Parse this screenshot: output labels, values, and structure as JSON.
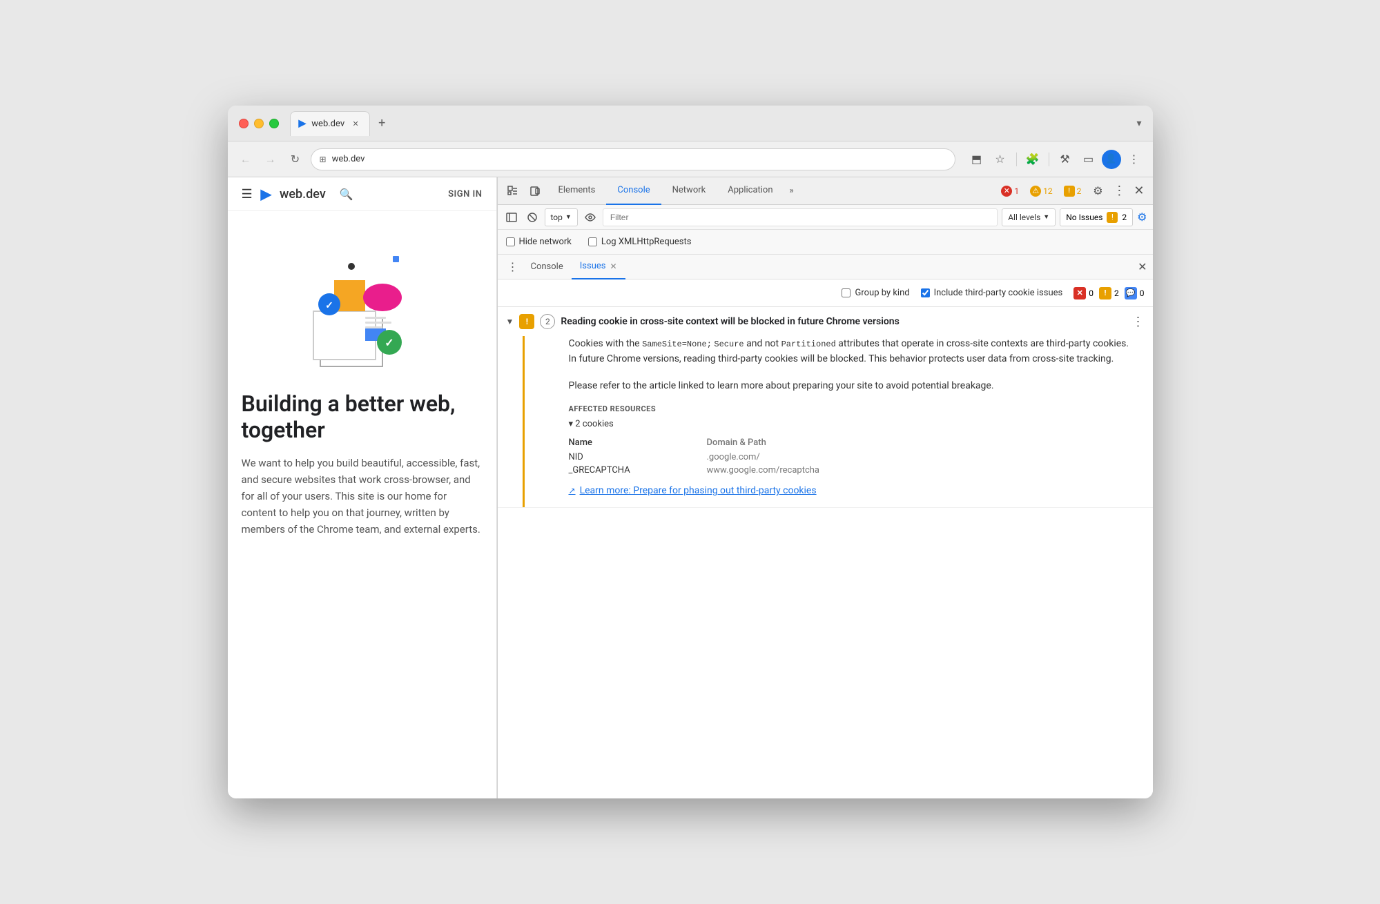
{
  "browser": {
    "title": "web.dev",
    "url": "web.dev",
    "favicon": "▶",
    "tab_close": "✕",
    "tab_new": "+",
    "back_btn": "←",
    "forward_btn": "→",
    "refresh_btn": "↻",
    "url_icon": "⊞"
  },
  "toolbar_icons": {
    "cast": "⬒",
    "bookmark": "☆",
    "extensions": "🧩",
    "devtools": "⚒",
    "profile": "👤",
    "menu": "⋮"
  },
  "site": {
    "hamburger": "☰",
    "logo": "▶",
    "name": "web.dev",
    "search": "🔍",
    "sign_in": "SIGN IN",
    "hero_title": "Building a better web, together",
    "hero_text": "We want to help you build beautiful, accessible, fast, and secure websites that work cross-browser, and for all of your users. This site is our home for content to help you on that journey, written by members of the Chrome team, and external experts."
  },
  "devtools": {
    "tabs": [
      {
        "label": "Elements",
        "active": false
      },
      {
        "label": "Console",
        "active": false
      },
      {
        "label": "Network",
        "active": false
      },
      {
        "label": "Application",
        "active": false
      },
      {
        "label": "»",
        "active": false
      }
    ],
    "active_tab": "Console",
    "error_count": "1",
    "warn_count": "12",
    "info_count": "2",
    "settings_icon": "⚙",
    "more_icon": "⋮",
    "close_icon": "✕",
    "inspect_icon": "⬚",
    "device_icon": "📱"
  },
  "console_toolbar": {
    "sidebar_icon": "▤",
    "clear_icon": "⊘",
    "context_label": "top",
    "dropdown_arrow": "▼",
    "eye_icon": "◉",
    "filter_placeholder": "Filter",
    "level_label": "All levels",
    "issues_label": "No Issues",
    "issues_count": "2",
    "settings_icon": "⚙"
  },
  "options": {
    "hide_network_label": "Hide network",
    "hide_network_checked": false,
    "log_xhr_label": "Log XMLHttpRequests",
    "log_xhr_checked": false
  },
  "sub_tabs": {
    "more_icon": "⋮",
    "tabs": [
      {
        "label": "Console",
        "active": false
      },
      {
        "label": "Issues",
        "active": true,
        "closeable": true
      }
    ],
    "close_icon": "✕"
  },
  "issues_options": {
    "group_by_kind_label": "Group by kind",
    "group_by_kind_checked": false,
    "include_third_party_label": "Include third-party cookie issues",
    "include_third_party_checked": true,
    "counts": [
      {
        "type": "error",
        "count": "0",
        "color": "red"
      },
      {
        "type": "warn",
        "count": "2",
        "color": "orange"
      },
      {
        "type": "info",
        "count": "0",
        "color": "blue"
      }
    ]
  },
  "issue": {
    "chevron": "▼",
    "warning_label": "!",
    "count": "2",
    "title": "Reading cookie in cross-site context will be blocked in future Chrome versions",
    "menu_icon": "⋮",
    "description_parts": {
      "intro": "Cookies with the ",
      "code1": "SameSite=None;",
      "mid1": " ",
      "code2": "Secure",
      "mid2": " and not ",
      "code3": "Partitioned",
      "outro": " attributes that operate in cross-site contexts are third-party cookies. In future Chrome versions, reading third-party cookies will be blocked. This behavior protects user data from cross-site tracking.",
      "para2": "Please refer to the article linked to learn more about preparing your site to avoid potential breakage."
    },
    "affected_resources_label": "AFFECTED RESOURCES",
    "cookies_toggle_label": "▾ 2 cookies",
    "table_headers": {
      "name": "Name",
      "domain": "Domain & Path"
    },
    "cookies": [
      {
        "name": "NID",
        "domain": ".google.com/"
      },
      {
        "name": "_GRECAPTCHA",
        "domain": "www.google.com/recaptcha"
      }
    ],
    "learn_more_text": "Learn more: Prepare for phasing out third-party cookies",
    "learn_more_icon": "⬡"
  }
}
